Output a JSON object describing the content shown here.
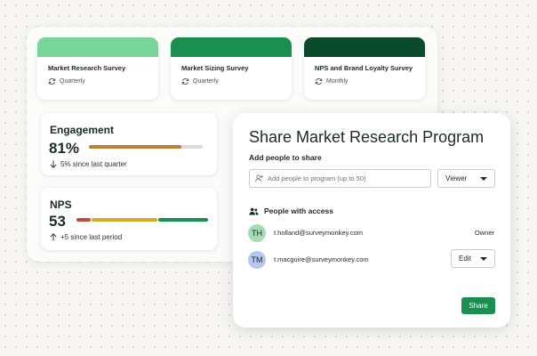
{
  "colors": {
    "survey_bars": [
      "#79d49b",
      "#1b8f52",
      "#0c4a2d"
    ],
    "engagement_fill": "#c07e36",
    "track": "#dcdcd8",
    "nps_segments": [
      "#bd4b3e",
      "#d6a92a",
      "#1b8f52"
    ],
    "accent": "#1b8f52",
    "avatar_th": "#a6dcb4",
    "avatar_tm": "#b7c7ee"
  },
  "surveys": [
    {
      "title": "Market Research Survey",
      "frequency": "Quarterly",
      "icon": "refresh-icon"
    },
    {
      "title": "Market Sizing Survey",
      "frequency": "Quarterly",
      "icon": "refresh-icon"
    },
    {
      "title": "NPS and Brand Loyalty Survey",
      "frequency": "Monthly",
      "icon": "refresh-icon"
    }
  ],
  "engagement": {
    "label": "Engagement",
    "value": "81%",
    "progress_fraction": 0.81,
    "change": "5% since last quarter",
    "change_icon": "arrow-down-icon"
  },
  "nps": {
    "label": "NPS",
    "value": "53",
    "change": "+5 since last period",
    "change_icon": "arrow-up-icon"
  },
  "share": {
    "title": "Share Market Research Program",
    "add_label": "Add people to share",
    "input_placeholder": "Add people to program (up to 50)",
    "default_role": "Viewer",
    "access_heading": "People with access",
    "people": [
      {
        "initials": "TH",
        "email": "t.holland@surveymonkey.com",
        "role": "Owner"
      },
      {
        "initials": "TM",
        "email": "t.macguire@surveymonkey.com",
        "role": "Edit"
      }
    ],
    "button_label": "Share"
  }
}
